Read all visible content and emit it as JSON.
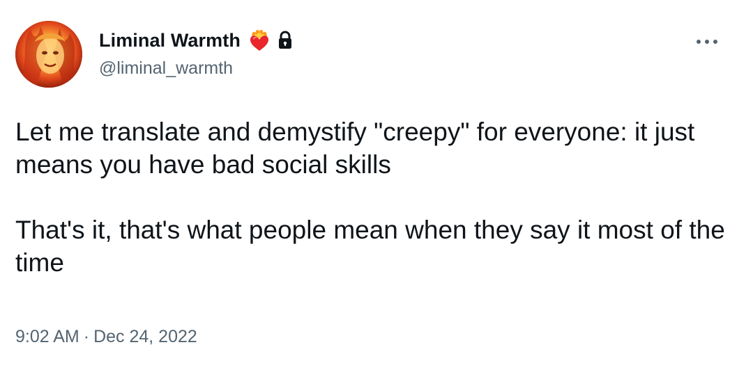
{
  "author": {
    "display_name": "Liminal Warmth",
    "handle": "@liminal_warmth",
    "avatar_icon": "fire-portrait-avatar",
    "badges": [
      "heart-on-fire-emoji",
      "lock-icon"
    ]
  },
  "tweet": {
    "paragraphs": [
      "Let me translate and demystify \"creepy\" for everyone: it just means you have bad social skills",
      "That's it, that's what people mean when they say it most of the time"
    ],
    "time": "9:02 AM",
    "separator": "·",
    "date": "Dec 24, 2022"
  },
  "colors": {
    "text": "#0f1419",
    "secondary": "#536471",
    "background": "#ffffff"
  }
}
